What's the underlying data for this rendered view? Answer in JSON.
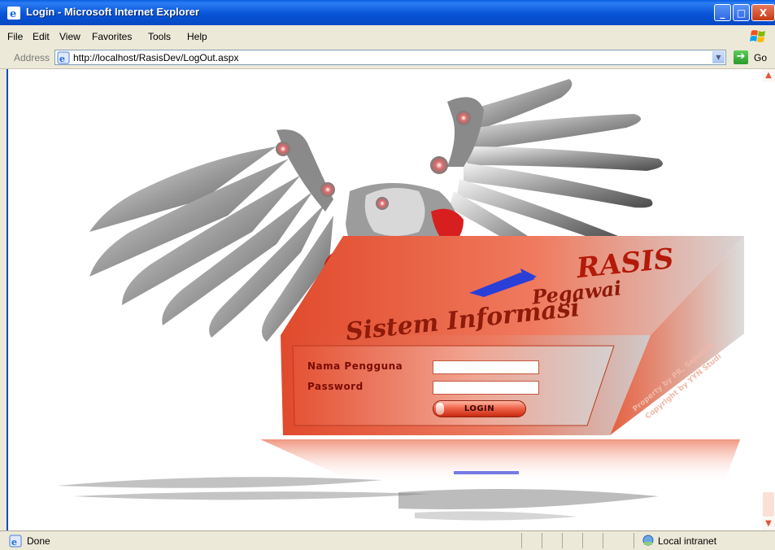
{
  "window": {
    "title": "Login - Microsoft Internet Explorer",
    "controls": {
      "minimize": "_",
      "maximize": "□",
      "close": "X"
    }
  },
  "menu": {
    "items": [
      "File",
      "Edit",
      "View",
      "Favorites",
      "Tools",
      "Help"
    ]
  },
  "address": {
    "label": "Address",
    "url": "http://localhost/RasisDev/LogOut.aspx",
    "go_label": "Go"
  },
  "page": {
    "brand_title": "RASIS",
    "brand_line1": "Pegawai",
    "brand_line2": "Sistem Informasi",
    "side_text_1": "Property by PR, Sejumuh",
    "side_text_2": "Copyright by YYN Studi",
    "username_label": "Nama Pengguna",
    "password_label": "Password",
    "username_value": "",
    "password_value": "",
    "login_button": "LOGIN"
  },
  "status": {
    "text": "Done",
    "zone": "Local intranet"
  },
  "colors": {
    "titlebar": "#0754d6",
    "box_orange": "#e8553a",
    "label_color": "#7a0c05"
  }
}
